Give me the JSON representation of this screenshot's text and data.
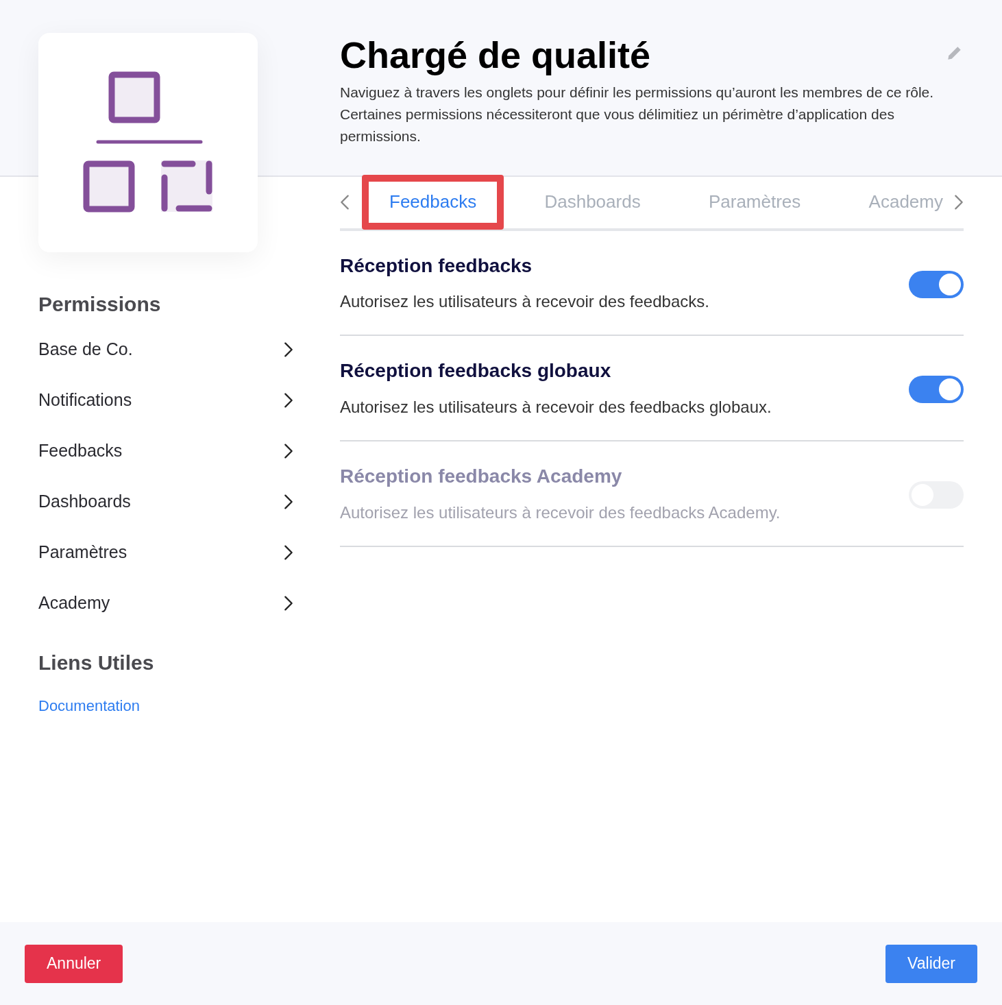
{
  "header": {
    "title": "Chargé de qualité",
    "description": "Naviguez à travers les onglets pour définir les permissions qu’auront les membres de ce rôle. Certaines permissions nécessiteront que vous délimitiez un périmètre d’application des permissions."
  },
  "sidebar": {
    "permissions_heading": "Permissions",
    "items": [
      "Base de Co.",
      "Notifications",
      "Feedbacks",
      "Dashboards",
      "Paramètres",
      "Academy"
    ],
    "links_heading": "Liens Utiles",
    "links": [
      "Documentation"
    ]
  },
  "tabs": [
    {
      "label": "Feedbacks",
      "selected": true,
      "highlighted": true
    },
    {
      "label": "Dashboards",
      "selected": false,
      "highlighted": false
    },
    {
      "label": "Paramètres",
      "selected": false,
      "highlighted": false
    },
    {
      "label": "Academy",
      "selected": false,
      "highlighted": false
    }
  ],
  "permissions": [
    {
      "title": "Réception feedbacks",
      "description": "Autorisez les utilisateurs à recevoir des feedbacks.",
      "on": true,
      "disabled": false
    },
    {
      "title": "Réception feedbacks globaux",
      "description": "Autorisez les utilisateurs à recevoir des feedbacks globaux.",
      "on": true,
      "disabled": false
    },
    {
      "title": "Réception feedbacks Academy",
      "description": "Autorisez les utilisateurs à recevoir des feedbacks Academy.",
      "on": false,
      "disabled": true
    }
  ],
  "footer": {
    "cancel": "Annuler",
    "confirm": "Valider"
  }
}
